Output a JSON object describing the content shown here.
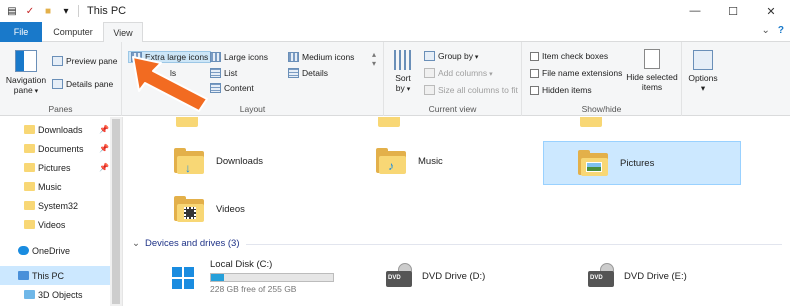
{
  "window": {
    "title": "This PC",
    "qat_icons": [
      "properties-icon",
      "checkmark-icon",
      "folder-icon",
      "dropdown-icon"
    ],
    "controls": [
      "minimize-icon",
      "maximize-icon",
      "close-icon"
    ]
  },
  "tabs": [
    "File",
    "Computer",
    "View"
  ],
  "ribbon": {
    "panes": {
      "label": "Panes",
      "navigation_pane": "Navigation",
      "navigation_pane_2": "pane",
      "preview_pane": "Preview pane",
      "details_pane": "Details pane"
    },
    "layout": {
      "label": "Layout",
      "extra_large_icons": "Extra large icons",
      "large_icons": "Large icons",
      "medium_icons": "Medium icons",
      "small_icons_partial": "ls",
      "list": "List",
      "details": "Details",
      "content": "Content"
    },
    "current_view": {
      "label": "Current view",
      "sort_by": "Sort",
      "sort_by_2": "by",
      "group_by": "Group by",
      "add_columns": "Add columns",
      "size_all_columns": "Size all columns to fit"
    },
    "show_hide": {
      "label": "Show/hide",
      "item_check_boxes": "Item check boxes",
      "file_name_extensions": "File name extensions",
      "hidden_items": "Hidden items",
      "hide_selected": "Hide selected",
      "hide_selected_2": "items"
    },
    "options": "Options"
  },
  "nav": [
    {
      "label": "Downloads",
      "pinned": true
    },
    {
      "label": "Documents",
      "pinned": true
    },
    {
      "label": "Pictures",
      "pinned": true
    },
    {
      "label": "Music",
      "pinned": false
    },
    {
      "label": "System32",
      "pinned": false
    },
    {
      "label": "Videos",
      "pinned": false
    },
    {
      "label": "OneDrive",
      "pinned": false
    },
    {
      "label": "This PC",
      "pinned": false
    },
    {
      "label": "3D Objects",
      "pinned": false
    }
  ],
  "folders": [
    {
      "label": "Downloads"
    },
    {
      "label": "Music"
    },
    {
      "label": "Pictures"
    },
    {
      "label": "Videos"
    }
  ],
  "devices_header": "Devices and drives (3)",
  "drives": [
    {
      "label": "Local Disk (C:)",
      "free": "228 GB free of 255 GB",
      "used_fraction": 0.106
    },
    {
      "label": "DVD Drive (D:)"
    },
    {
      "label": "DVD Drive (E:)"
    }
  ],
  "colors": {
    "accent": "#1979ca",
    "selection": "#cce8ff",
    "arrow": "#f26b21",
    "folder": "#f8d775"
  }
}
